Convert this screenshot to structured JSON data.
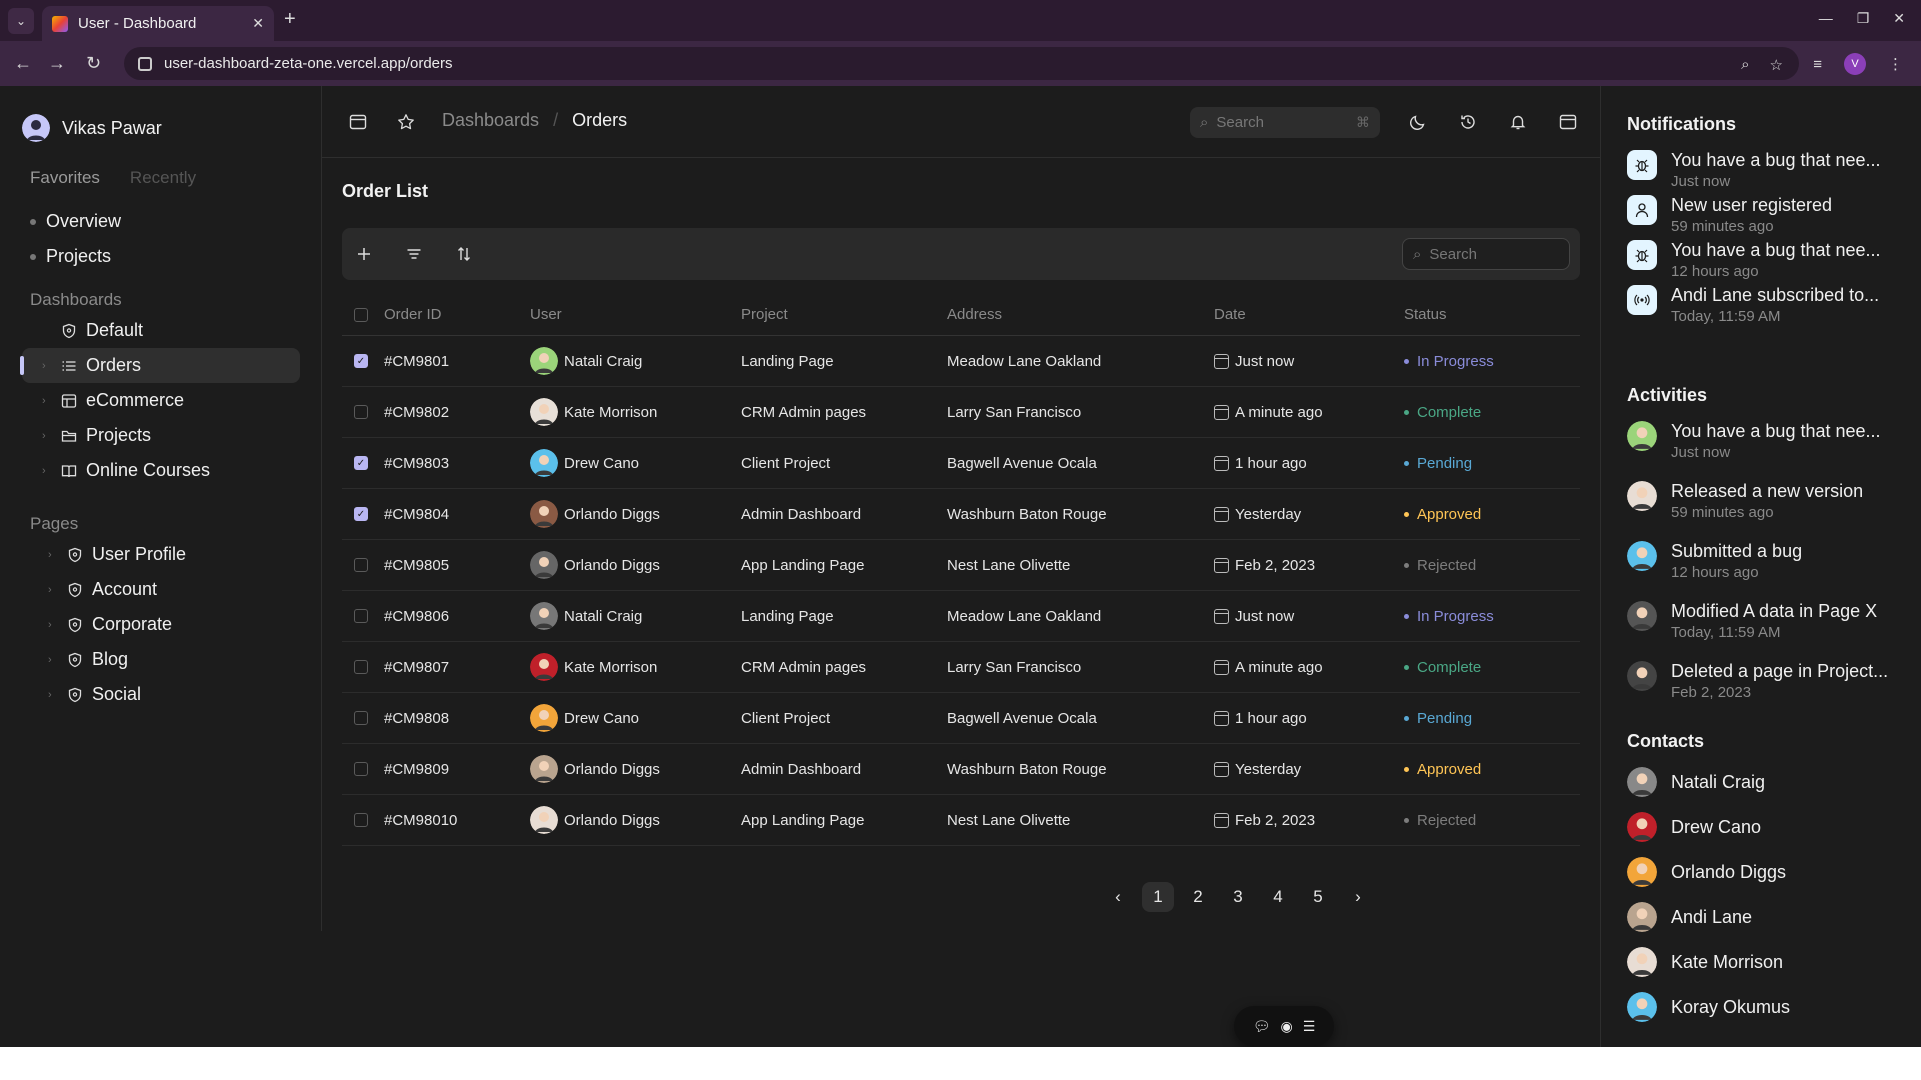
{
  "browser": {
    "tab_title": "User - Dashboard",
    "tab_close": "✕",
    "new_tab": "+",
    "url": "user-dashboard-zeta-one.vercel.app/orders",
    "profile_initial": "V"
  },
  "sidebar": {
    "user_name": "Vikas Pawar",
    "tabs": [
      "Favorites",
      "Recently"
    ],
    "favorites": [
      "Overview",
      "Projects"
    ],
    "dashboards_label": "Dashboards",
    "dashboards": [
      {
        "label": "Default",
        "icon": "shield-icon"
      },
      {
        "label": "Orders",
        "icon": "list-icon"
      },
      {
        "label": "eCommerce",
        "icon": "table-icon"
      },
      {
        "label": "Projects",
        "icon": "folder-icon"
      },
      {
        "label": "Online Courses",
        "icon": "book-icon"
      }
    ],
    "pages_label": "Pages",
    "pages": [
      {
        "label": "User Profile",
        "icon": "shield-icon"
      },
      {
        "label": "Account",
        "icon": "shield-icon"
      },
      {
        "label": "Corporate",
        "icon": "shield-icon"
      },
      {
        "label": "Blog",
        "icon": "shield-icon"
      },
      {
        "label": "Social",
        "icon": "shield-icon"
      }
    ]
  },
  "topbar": {
    "breadcrumb": [
      "Dashboards",
      "Orders"
    ],
    "breadcrumb_sep": "/",
    "search_placeholder": "Search",
    "search_kbd": "⌘"
  },
  "main": {
    "title": "Order List",
    "table_search_placeholder": "Search",
    "columns": [
      "Order ID",
      "User",
      "Project",
      "Address",
      "Date",
      "Status"
    ],
    "rows": [
      {
        "checked": true,
        "id": "#CM9801",
        "user": "Natali Craig",
        "project": "Landing Page",
        "address": "Meadow Lane Oakland",
        "date": "Just now",
        "status": "In Progress"
      },
      {
        "checked": false,
        "id": "#CM9802",
        "user": "Kate Morrison",
        "project": "CRM Admin pages",
        "address": "Larry San Francisco",
        "date": "A minute ago",
        "status": "Complete"
      },
      {
        "checked": true,
        "id": "#CM9803",
        "user": "Drew Cano",
        "project": "Client Project",
        "address": "Bagwell Avenue Ocala",
        "date": "1 hour ago",
        "status": "Pending"
      },
      {
        "checked": true,
        "id": "#CM9804",
        "user": "Orlando Diggs",
        "project": "Admin Dashboard",
        "address": "Washburn Baton Rouge",
        "date": "Yesterday",
        "status": "Approved"
      },
      {
        "checked": false,
        "id": "#CM9805",
        "user": "Orlando Diggs",
        "project": "App Landing Page",
        "address": "Nest Lane Olivette",
        "date": "Feb 2, 2023",
        "status": "Rejected"
      },
      {
        "checked": false,
        "id": "#CM9806",
        "user": "Natali Craig",
        "project": "Landing Page",
        "address": "Meadow Lane Oakland",
        "date": "Just now",
        "status": "In Progress"
      },
      {
        "checked": false,
        "id": "#CM9807",
        "user": "Kate Morrison",
        "project": "CRM Admin pages",
        "address": "Larry San Francisco",
        "date": "A minute ago",
        "status": "Complete"
      },
      {
        "checked": false,
        "id": "#CM9808",
        "user": "Drew Cano",
        "project": "Client Project",
        "address": "Bagwell Avenue Ocala",
        "date": "1 hour ago",
        "status": "Pending"
      },
      {
        "checked": false,
        "id": "#CM9809",
        "user": "Orlando Diggs",
        "project": "Admin Dashboard",
        "address": "Washburn Baton Rouge",
        "date": "Yesterday",
        "status": "Approved"
      },
      {
        "checked": false,
        "id": "#CM98010",
        "user": "Orlando Diggs",
        "project": "App Landing Page",
        "address": "Nest Lane Olivette",
        "date": "Feb 2, 2023",
        "status": "Rejected"
      }
    ],
    "status_colors": {
      "In Progress": "#8a8cd9",
      "Complete": "#4aa785",
      "Pending": "#59a8d4",
      "Approved": "#ffc555",
      "Rejected": "#7d7d7d"
    },
    "pages": [
      "1",
      "2",
      "3",
      "4",
      "5"
    ],
    "current_page": "1",
    "pager_prev": "‹",
    "pager_next": "›"
  },
  "rightpanel": {
    "notifications_title": "Notifications",
    "notifications": [
      {
        "text": "You have a bug that nee...",
        "time": "Just now",
        "icon": "bug-icon"
      },
      {
        "text": "New user registered",
        "time": "59 minutes ago",
        "icon": "user-icon"
      },
      {
        "text": "You have a bug that nee...",
        "time": "12 hours ago",
        "icon": "bug-icon"
      },
      {
        "text": "Andi Lane subscribed to...",
        "time": "Today, 11:59 AM",
        "icon": "broadcast-icon"
      }
    ],
    "activities_title": "Activities",
    "activities": [
      {
        "text": "You have a bug that nee...",
        "time": "Just now"
      },
      {
        "text": "Released a new version",
        "time": "59 minutes ago"
      },
      {
        "text": "Submitted a bug",
        "time": "12 hours ago"
      },
      {
        "text": "Modified A data in Page X",
        "time": "Today, 11:59 AM"
      },
      {
        "text": "Deleted a page in Project...",
        "time": "Feb 2, 2023"
      }
    ],
    "contacts_title": "Contacts",
    "contacts": [
      "Natali Craig",
      "Drew Cano",
      "Orlando Diggs",
      "Andi Lane",
      "Kate Morrison",
      "Koray Okumus"
    ]
  },
  "colors": {
    "accent": "#c6c7f8",
    "background": "#1c1c1c",
    "chrome": "#3c2743"
  }
}
